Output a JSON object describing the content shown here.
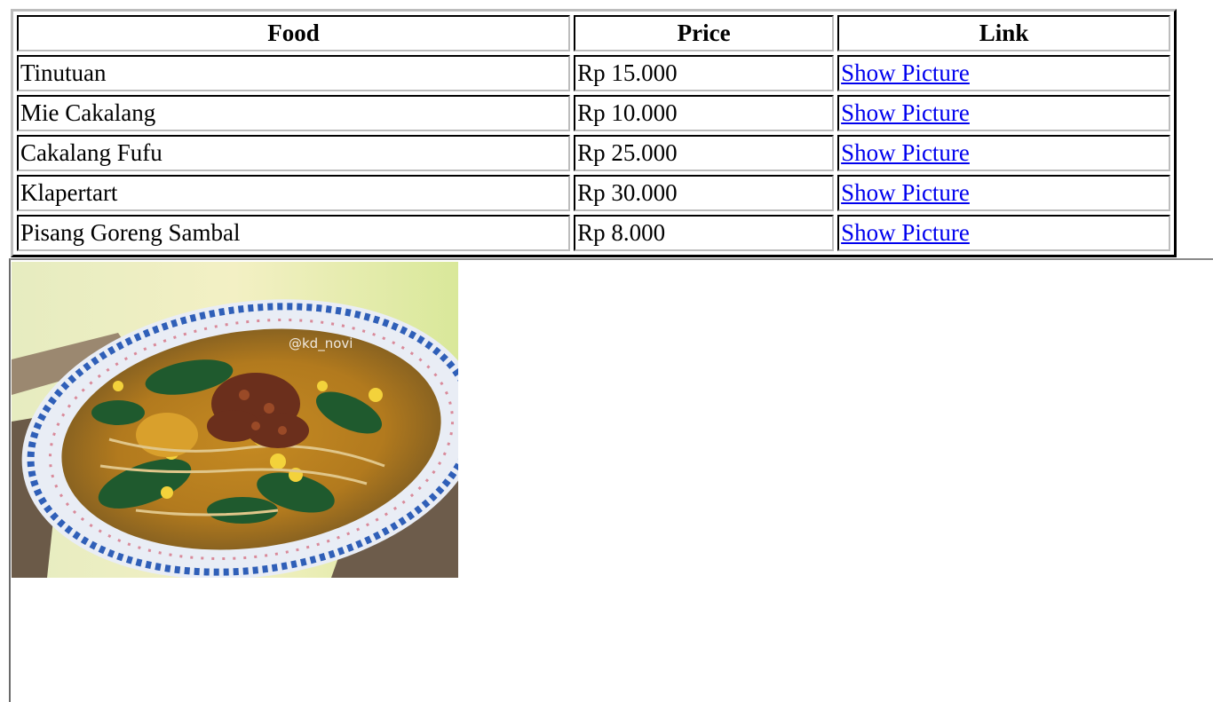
{
  "table": {
    "headers": {
      "food": "Food",
      "price": "Price",
      "link": "Link"
    },
    "rows": [
      {
        "food": "Tinutuan",
        "price": "Rp 15.000",
        "link": "Show Picture"
      },
      {
        "food": "Mie Cakalang",
        "price": "Rp 10.000",
        "link": "Show Picture"
      },
      {
        "food": "Cakalang Fufu",
        "price": "Rp 25.000",
        "link": "Show Picture"
      },
      {
        "food": "Klapertart",
        "price": "Rp 30.000",
        "link": "Show Picture"
      },
      {
        "food": "Pisang Goreng Sambal",
        "price": "Rp 8.000",
        "link": "Show Picture"
      }
    ]
  },
  "picture": {
    "watermark": "@kd_novi",
    "icon": "food-photo"
  },
  "colors": {
    "link": "#0000ee",
    "text": "#000000"
  }
}
